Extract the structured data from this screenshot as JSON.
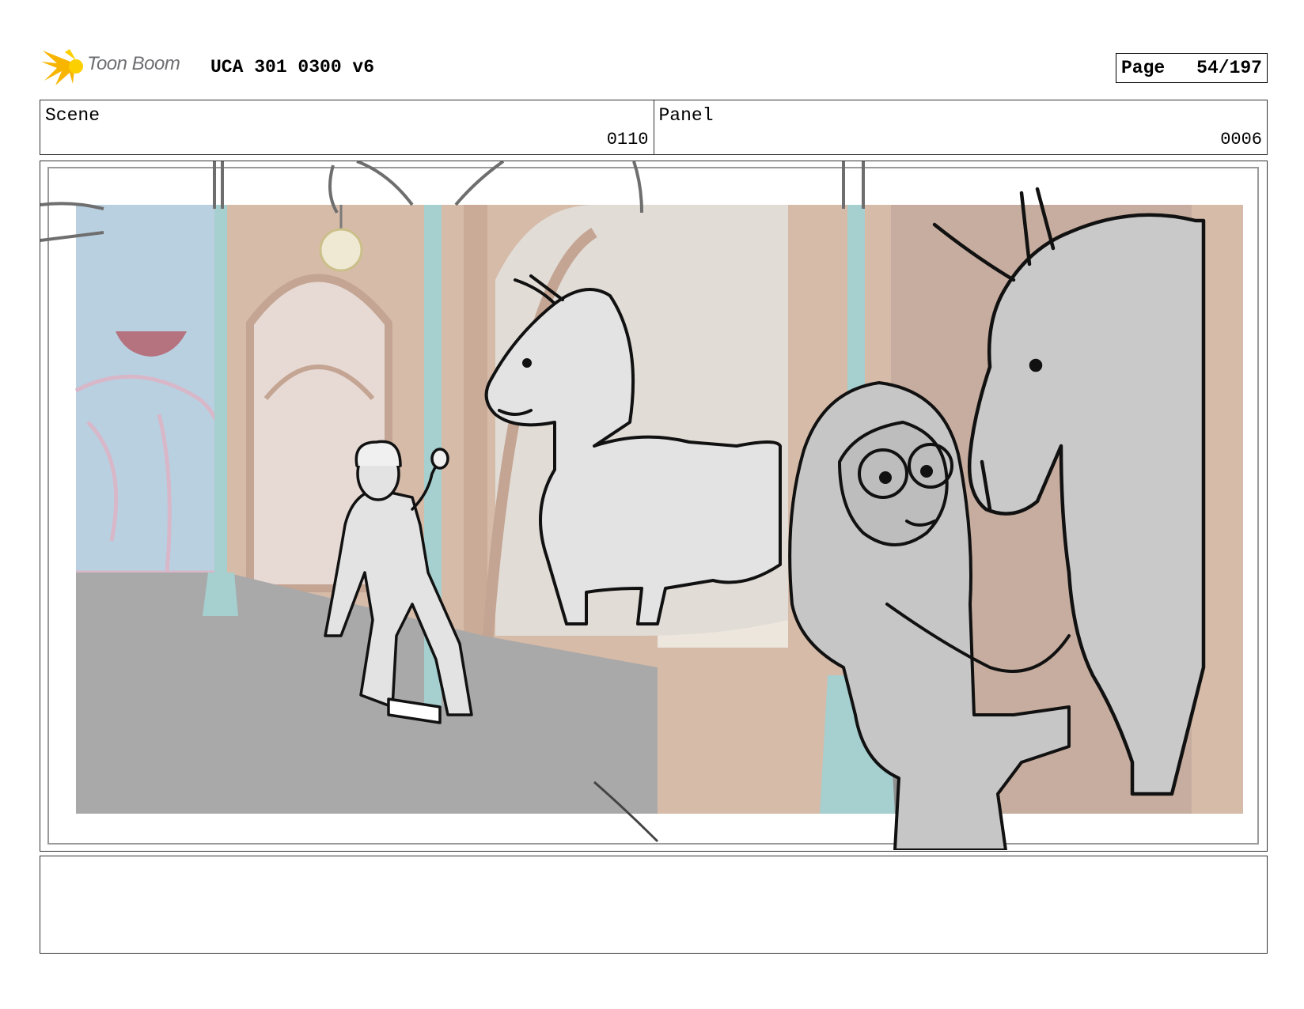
{
  "header": {
    "brand": "Toon Boom",
    "title": "UCA 301 0300 v6",
    "page_label": "Page",
    "page_number": "54/197"
  },
  "info": {
    "scene_label": "Scene",
    "scene_value": "0110",
    "panel_label": "Panel",
    "panel_value": "0006"
  },
  "notes": {
    "text": ""
  },
  "colors": {
    "sky": "#b9d0e1",
    "wall_tan": "#d6bba8",
    "floor": "#a9a9a9",
    "pillar_teal": "#a6cfcf",
    "logo_yellow": "#f7b500"
  }
}
